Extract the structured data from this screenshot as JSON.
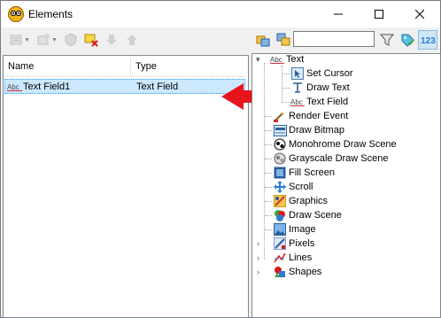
{
  "window": {
    "title": "Elements",
    "minimize_icon": "minimize-icon",
    "maximize_icon": "maximize-icon",
    "close_icon": "close-icon"
  },
  "search": {
    "value": ""
  },
  "list": {
    "columns": [
      "Name",
      "Type"
    ],
    "rows": [
      {
        "name": "Text Field1",
        "type": "Text Field",
        "icon": "text-field-icon"
      }
    ]
  },
  "tree": {
    "text_group": {
      "label": "Text",
      "children": [
        "Set Cursor",
        "Draw Text",
        "Text Field"
      ]
    },
    "items": [
      "Render Event",
      "Draw Bitmap",
      "Monohrome Draw Scene",
      "Grayscale Draw Scene",
      "Fill Screen",
      "Scroll",
      "Graphics",
      "Draw Scene",
      "Image",
      "Pixels",
      "Lines",
      "Shapes"
    ]
  },
  "annotation": {
    "arrow_color": "#e8141c"
  },
  "colors": {
    "selection": "#cce8ff",
    "accent": "#3399ff"
  }
}
